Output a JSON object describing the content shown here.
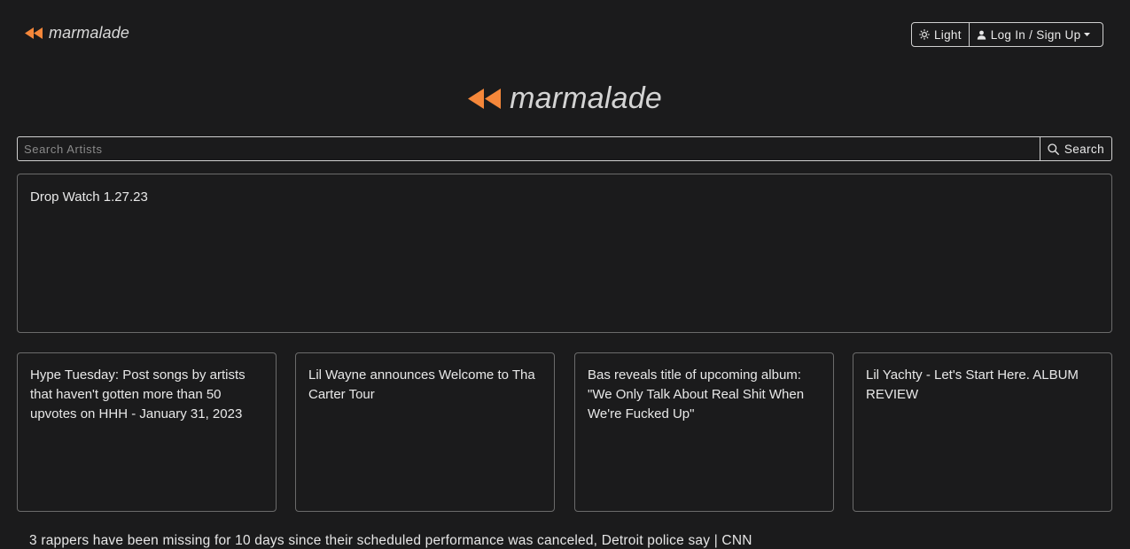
{
  "colors": {
    "background": "#1b1b1c",
    "accent": "#f5873a",
    "text": "#e6e6e6",
    "border": "#6b6b6b"
  },
  "header": {
    "brand": "marmalade",
    "brand_icon": "rewind-icon",
    "theme_button_label": "Light",
    "theme_icon": "sun-icon",
    "login_button_label": "Log In / Sign Up",
    "login_icon": "user-icon"
  },
  "hero": {
    "brand": "marmalade",
    "brand_icon": "rewind-icon"
  },
  "search": {
    "placeholder": "Search Artists",
    "value": "",
    "button_label": "Search",
    "button_icon": "search-icon"
  },
  "featured": {
    "title": "Drop Watch 1.27.23"
  },
  "cards": [
    {
      "title": "Hype Tuesday: Post songs by artists that haven't gotten more than 50 upvotes on HHH - January 31, 2023"
    },
    {
      "title": "Lil Wayne announces Welcome to Tha Carter Tour"
    },
    {
      "title": "Bas reveals title of upcoming album: \"We Only Talk About Real Shit When We're Fucked Up\""
    },
    {
      "title": "Lil Yachty - Let's Start Here. ALBUM REVIEW"
    }
  ],
  "headline": {
    "text": "3 rappers have been missing for 10 days since their scheduled performance was canceled, Detroit police say | CNN"
  }
}
